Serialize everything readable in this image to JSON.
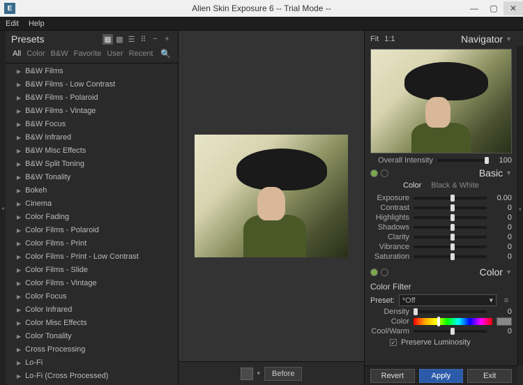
{
  "window": {
    "title": "Alien Skin Exposure 6 -- Trial Mode --",
    "icon_letter": "E"
  },
  "menu": {
    "edit": "Edit",
    "help": "Help"
  },
  "presets": {
    "title": "Presets",
    "filters": [
      "All",
      "Color",
      "B&W",
      "Favorite",
      "User",
      "Recent"
    ],
    "items": [
      "B&W Films",
      "B&W Films - Low Contrast",
      "B&W Films - Polaroid",
      "B&W Films - Vintage",
      "B&W Focus",
      "B&W Infrared",
      "B&W Misc Effects",
      "B&W Split Toning",
      "B&W Tonality",
      "Bokeh",
      "Cinema",
      "Color Fading",
      "Color Films - Polaroid",
      "Color Films - Print",
      "Color Films - Print - Low Contrast",
      "Color Films - Slide",
      "Color Films - Vintage",
      "Color Focus",
      "Color Infrared",
      "Color Misc Effects",
      "Color Tonality",
      "Cross Processing",
      "Lo-Fi",
      "Lo-Fi (Cross Processed)"
    ]
  },
  "center": {
    "before_label": "Before"
  },
  "navigator": {
    "fit": "Fit",
    "one_to_one": "1:1",
    "title": "Navigator",
    "overall_intensity_label": "Overall Intensity",
    "overall_intensity_value": "100"
  },
  "basic": {
    "title": "Basic",
    "mode_color": "Color",
    "mode_bw": "Black & White",
    "rows": [
      {
        "label": "Exposure",
        "value": "0.00",
        "pos": 50
      },
      {
        "label": "Contrast",
        "value": "0",
        "pos": 50
      },
      {
        "label": "Highlights",
        "value": "0",
        "pos": 50
      },
      {
        "label": "Shadows",
        "value": "0",
        "pos": 50
      },
      {
        "label": "Clarity",
        "value": "0",
        "pos": 50
      },
      {
        "label": "Vibrance",
        "value": "0",
        "pos": 50
      },
      {
        "label": "Saturation",
        "value": "0",
        "pos": 50
      }
    ]
  },
  "color": {
    "title": "Color",
    "filter_label": "Color Filter",
    "preset_label": "Preset:",
    "preset_value": "*Off",
    "density_label": "Density",
    "density_value": "0",
    "color_label": "Color",
    "coolwarm_label": "Cool/Warm",
    "coolwarm_value": "0",
    "preserve_label": "Preserve Luminosity"
  },
  "footer": {
    "revert": "Revert",
    "apply": "Apply",
    "exit": "Exit"
  }
}
